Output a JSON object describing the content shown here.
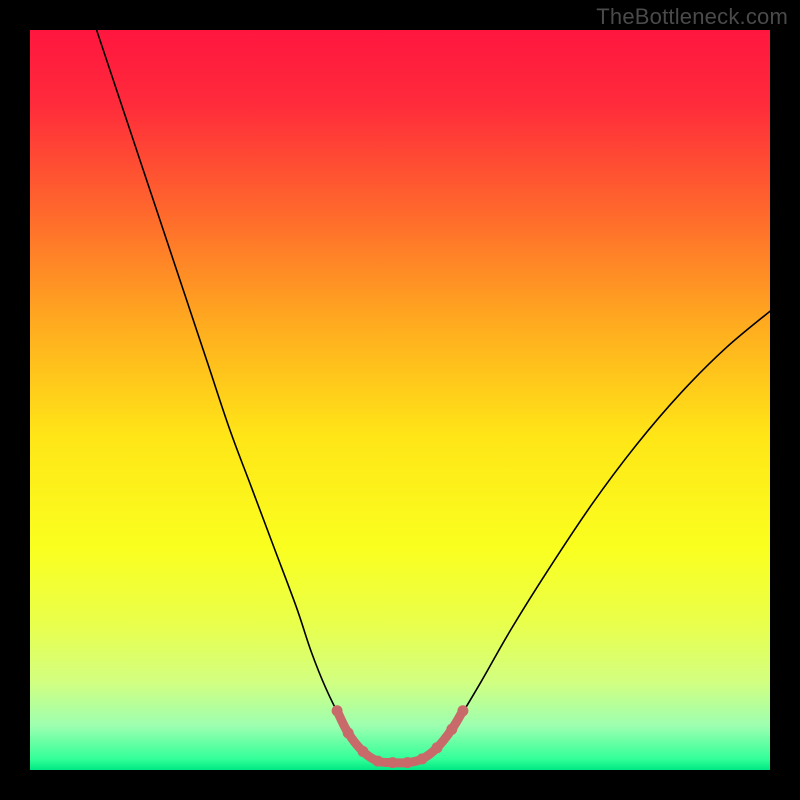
{
  "watermark": "TheBottleneck.com",
  "chart_data": {
    "type": "line",
    "title": "",
    "xlabel": "",
    "ylabel": "",
    "xlim": [
      0,
      100
    ],
    "ylim": [
      0,
      100
    ],
    "background": {
      "type": "vertical-gradient",
      "stops": [
        {
          "offset": 0.0,
          "color": "#ff163f"
        },
        {
          "offset": 0.1,
          "color": "#ff2b3b"
        },
        {
          "offset": 0.25,
          "color": "#ff6a2c"
        },
        {
          "offset": 0.4,
          "color": "#ffac1f"
        },
        {
          "offset": 0.55,
          "color": "#ffe617"
        },
        {
          "offset": 0.7,
          "color": "#faff1f"
        },
        {
          "offset": 0.8,
          "color": "#e9ff4a"
        },
        {
          "offset": 0.88,
          "color": "#d3ff80"
        },
        {
          "offset": 0.94,
          "color": "#9dffb0"
        },
        {
          "offset": 0.985,
          "color": "#33ff99"
        },
        {
          "offset": 1.0,
          "color": "#00e884"
        }
      ]
    },
    "series": [
      {
        "name": "bottleneck-curve",
        "stroke": "#000000",
        "stroke_width": 1.6,
        "points": [
          {
            "x": 9.0,
            "y": 100.0
          },
          {
            "x": 12.0,
            "y": 91.0
          },
          {
            "x": 15.0,
            "y": 82.0
          },
          {
            "x": 18.0,
            "y": 73.0
          },
          {
            "x": 21.0,
            "y": 64.0
          },
          {
            "x": 24.0,
            "y": 55.0
          },
          {
            "x": 27.0,
            "y": 46.0
          },
          {
            "x": 30.0,
            "y": 38.0
          },
          {
            "x": 33.0,
            "y": 30.0
          },
          {
            "x": 36.0,
            "y": 22.0
          },
          {
            "x": 38.0,
            "y": 16.0
          },
          {
            "x": 40.0,
            "y": 11.0
          },
          {
            "x": 42.0,
            "y": 7.0
          },
          {
            "x": 44.0,
            "y": 4.0
          },
          {
            "x": 46.0,
            "y": 2.0
          },
          {
            "x": 48.0,
            "y": 1.0
          },
          {
            "x": 50.0,
            "y": 1.0
          },
          {
            "x": 52.0,
            "y": 1.0
          },
          {
            "x": 54.0,
            "y": 2.0
          },
          {
            "x": 56.0,
            "y": 4.0
          },
          {
            "x": 58.0,
            "y": 7.0
          },
          {
            "x": 61.0,
            "y": 12.0
          },
          {
            "x": 65.0,
            "y": 19.0
          },
          {
            "x": 70.0,
            "y": 27.0
          },
          {
            "x": 76.0,
            "y": 36.0
          },
          {
            "x": 82.0,
            "y": 44.0
          },
          {
            "x": 88.0,
            "y": 51.0
          },
          {
            "x": 94.0,
            "y": 57.0
          },
          {
            "x": 100.0,
            "y": 62.0
          }
        ]
      },
      {
        "name": "valley-highlight",
        "stroke": "#c96a6a",
        "stroke_width": 9,
        "marker_color": "#c96a6a",
        "marker_radius": 5.5,
        "points": [
          {
            "x": 41.5,
            "y": 8.0
          },
          {
            "x": 43.0,
            "y": 5.0
          },
          {
            "x": 45.0,
            "y": 2.5
          },
          {
            "x": 47.0,
            "y": 1.2
          },
          {
            "x": 49.0,
            "y": 1.0
          },
          {
            "x": 51.0,
            "y": 1.0
          },
          {
            "x": 53.0,
            "y": 1.5
          },
          {
            "x": 55.0,
            "y": 3.0
          },
          {
            "x": 57.0,
            "y": 5.5
          },
          {
            "x": 58.5,
            "y": 8.0
          }
        ]
      }
    ]
  }
}
